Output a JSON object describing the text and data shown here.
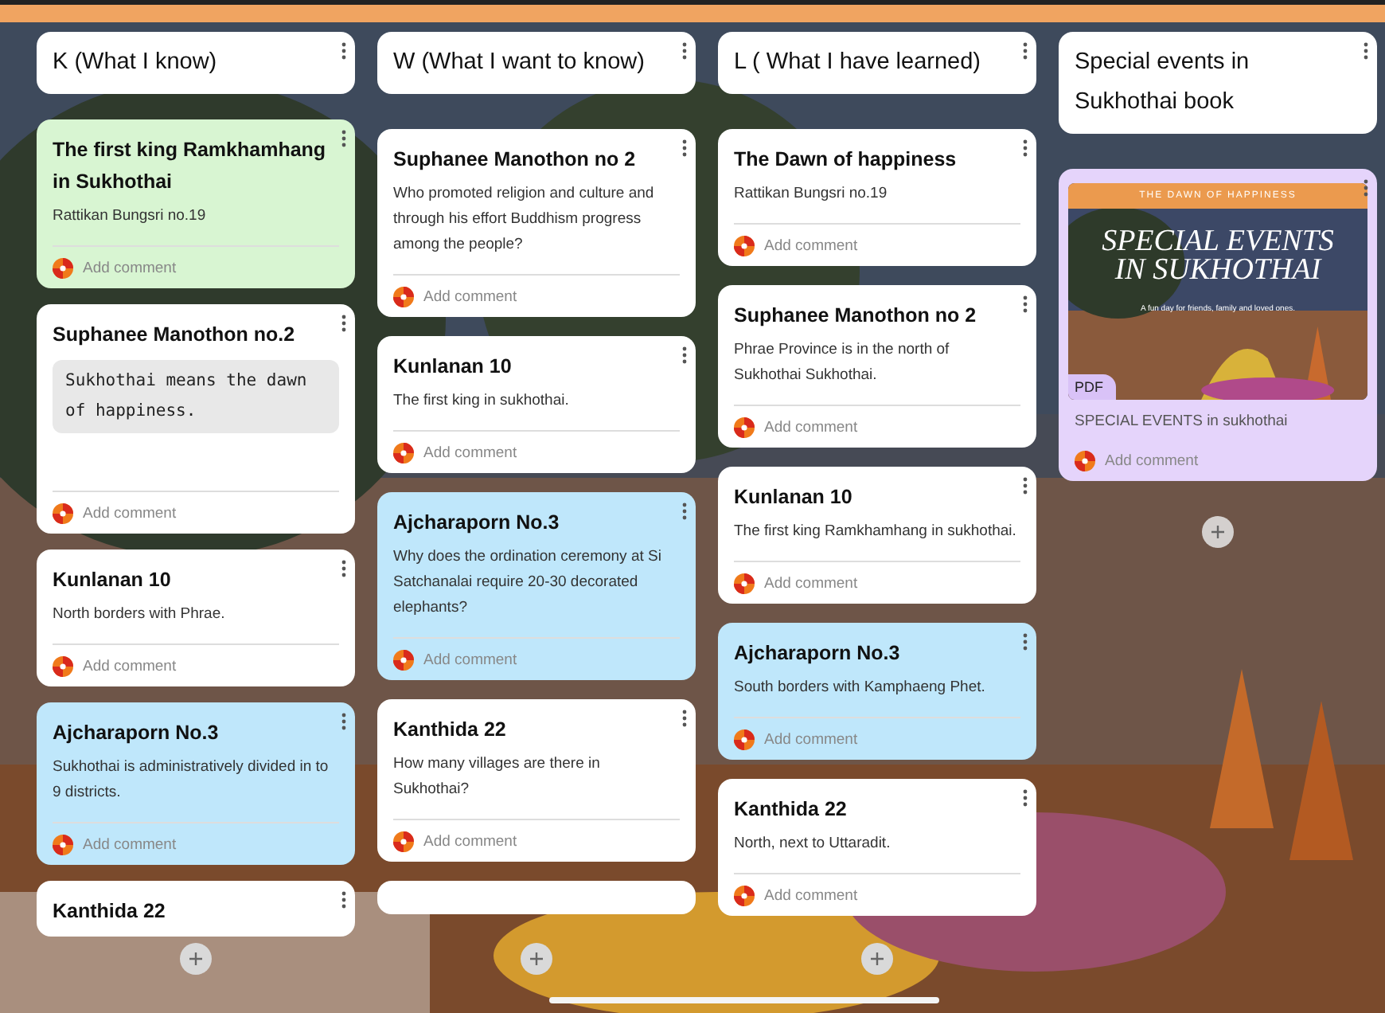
{
  "columns": [
    {
      "header": "K (What I know)",
      "cards": [
        {
          "kind": "note",
          "color": "#d8f5d2",
          "title": "The first king Ramkhamhang in Sukhothai",
          "body": "Rattikan Bungsri no.19",
          "comment": "Add comment"
        },
        {
          "kind": "code_note",
          "color": "#ffffff",
          "title": "Suphanee Manothon no.2",
          "body": "Sukhothai means the dawn of happiness.",
          "comment": "Add comment"
        },
        {
          "kind": "note",
          "color": "#ffffff",
          "title": "Kunlanan 10",
          "body": "North  borders with Phrae.",
          "comment": "Add comment"
        },
        {
          "kind": "note",
          "color": "#bfe7fb",
          "title": "Ajcharaporn No.3",
          "body": "Sukhothai is administratively divided in to 9 districts.",
          "comment": "Add comment"
        },
        {
          "kind": "note",
          "color": "#ffffff",
          "title": "Kanthida 22"
        }
      ]
    },
    {
      "header": "W (What I want to know)",
      "cards": [
        {
          "kind": "note",
          "color": "#ffffff",
          "title": "Suphanee Manothon no 2",
          "body": "Who promoted religion and culture and through his effort Buddhism progress among the people?",
          "comment": "Add comment"
        },
        {
          "kind": "note",
          "color": "#ffffff",
          "title": "Kunlanan 10",
          "body": "The first king in sukhothai.",
          "comment": "Add comment"
        },
        {
          "kind": "note",
          "color": "#bfe7fb",
          "title": "Ajcharaporn No.3",
          "body": "Why does the ordination ceremony at Si Satchanalai require 20-30 decorated elephants?",
          "comment": "Add comment"
        },
        {
          "kind": "note",
          "color": "#ffffff",
          "title": "Kanthida 22",
          "body": "How many villages are there in Sukhothai?",
          "comment": "Add comment"
        },
        {
          "kind": "note",
          "color": "#ffffff"
        }
      ]
    },
    {
      "header": "L ( What I have learned)",
      "cards": [
        {
          "kind": "note",
          "color": "#ffffff",
          "title": "The Dawn of happiness",
          "body": "Rattikan Bungsri no.19",
          "comment": "Add comment"
        },
        {
          "kind": "note",
          "color": "#ffffff",
          "title": "Suphanee Manothon no 2",
          "body": "Phrae Province is in the north of Sukhothai Sukhothai.",
          "comment": "Add comment"
        },
        {
          "kind": "note",
          "color": "#ffffff",
          "title": "Kunlanan 10",
          "body": "The first king Ramkhamhang in sukhothai.",
          "comment": "Add comment"
        },
        {
          "kind": "note",
          "color": "#bfe7fb",
          "title": "Ajcharaporn No.3",
          "body": "South borders with Kamphaeng Phet.",
          "comment": "Add comment"
        },
        {
          "kind": "note",
          "color": "#ffffff",
          "title": "Kanthida 22",
          "body": "North, next to Uttaradit.",
          "comment": "Add comment"
        }
      ]
    },
    {
      "header": "Special events in Sukhothai book",
      "cards": [
        {
          "kind": "attachment",
          "color": "#e5d4fb",
          "cover_band": "THE DAWN OF HAPPINESS",
          "cover_title": "SPECIAL EVENTS IN SUKHOTHAI",
          "cover_subtitle": "A fun day for friends, family and loved ones.",
          "file_type": "PDF",
          "caption": "SPECIAL EVENTS in sukhothai",
          "comment": "Add comment"
        }
      ]
    }
  ]
}
